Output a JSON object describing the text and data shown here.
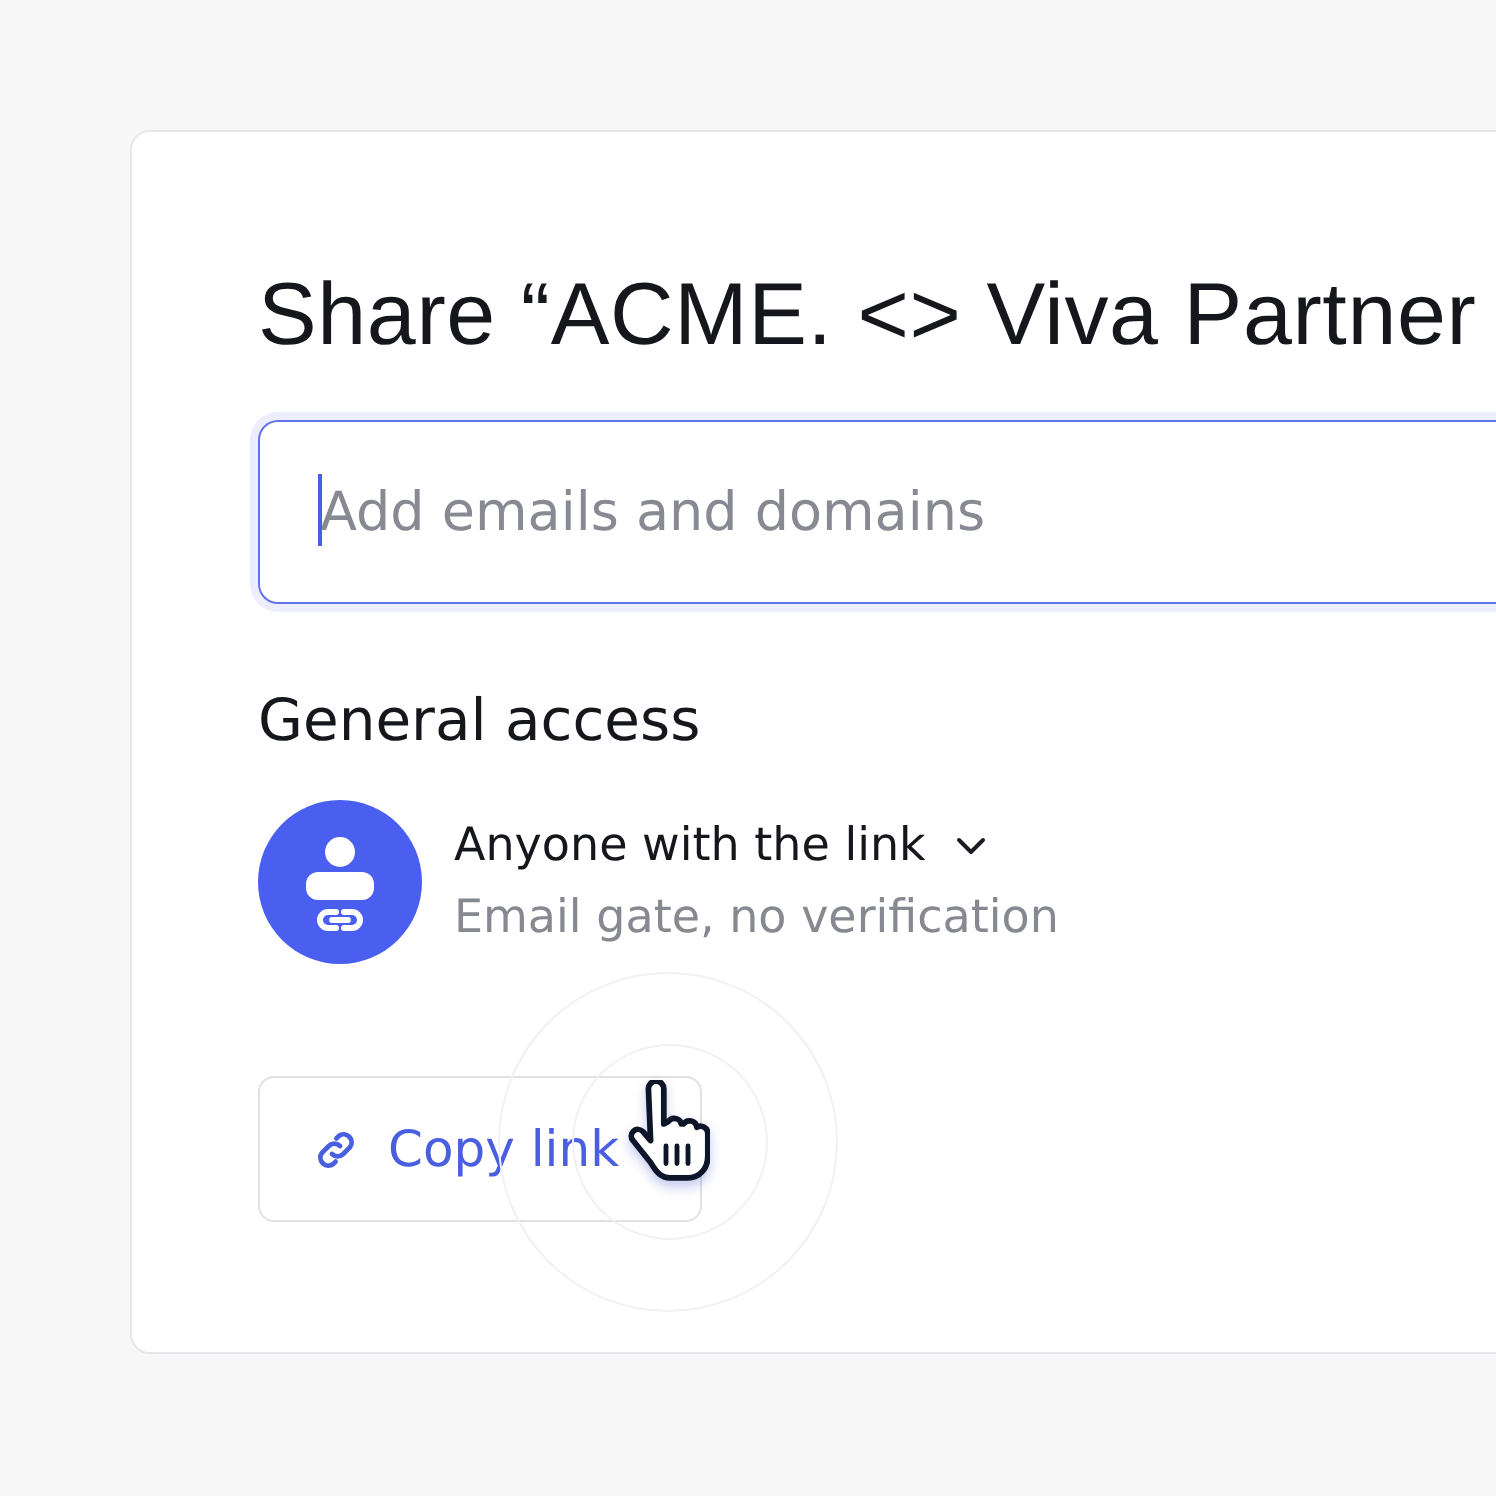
{
  "dialog": {
    "title": "Share “ACME. <> Viva Partner"
  },
  "invite": {
    "placeholder": "Add emails and domains",
    "focused": true
  },
  "general_access": {
    "heading": "General access",
    "option": "Anyone with the link",
    "description": "Email gate, no verification"
  },
  "buttons": [
    {
      "label": "Copy link",
      "kind": "copy-link"
    }
  ]
}
